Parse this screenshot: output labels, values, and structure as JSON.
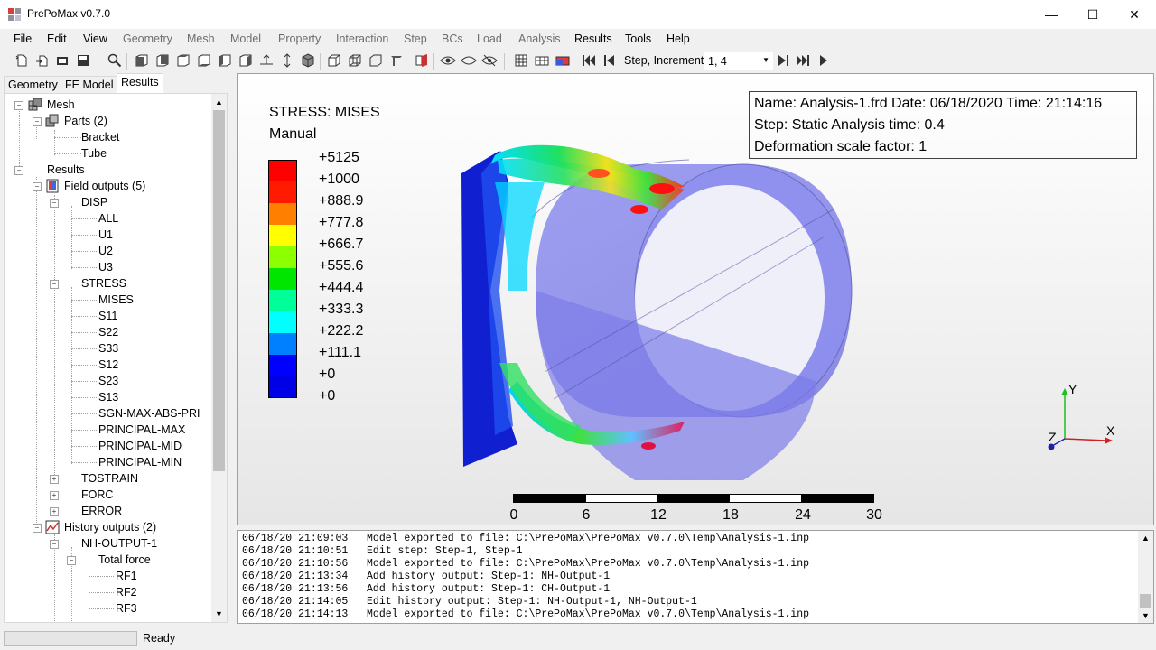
{
  "window": {
    "title": "PrePoMax v0.7.0",
    "minimize": "—",
    "maximize": "☐",
    "close": "✕"
  },
  "menu": [
    {
      "label": "File"
    },
    {
      "label": "Edit"
    },
    {
      "label": "View"
    },
    {
      "label": "Geometry"
    },
    {
      "label": "Mesh"
    },
    {
      "label": "Model"
    },
    {
      "label": "Property"
    },
    {
      "label": "Interaction"
    },
    {
      "label": "Step"
    },
    {
      "label": "BCs"
    },
    {
      "label": "Load"
    },
    {
      "label": "Analysis"
    },
    {
      "label": "Results"
    },
    {
      "label": "Tools"
    },
    {
      "label": "Help"
    }
  ],
  "toolbar": {
    "step_label": "Step, Increment",
    "step_value": "1, 4"
  },
  "left_tabs": [
    "Geometry",
    "FE Model",
    "Results"
  ],
  "tree": {
    "mesh": "Mesh",
    "parts": "Parts (2)",
    "bracket": "Bracket",
    "tube": "Tube",
    "results": "Results",
    "field_outputs": "Field outputs (5)",
    "disp": "DISP",
    "all": "ALL",
    "u1": "U1",
    "u2": "U2",
    "u3": "U3",
    "stress": "STRESS",
    "mises": "MISES",
    "s11": "S11",
    "s22": "S22",
    "s33": "S33",
    "s12": "S12",
    "s23": "S23",
    "s13": "S13",
    "sgn": "SGN-MAX-ABS-PRI",
    "pmax": "PRINCIPAL-MAX",
    "pmid": "PRINCIPAL-MID",
    "pmin": "PRINCIPAL-MIN",
    "tostrain": "TOSTRAIN",
    "forc": "FORC",
    "error": "ERROR",
    "history_outputs": "History outputs (2)",
    "nh_output": "NH-OUTPUT-1",
    "total_force": "Total force",
    "rf1": "RF1",
    "rf2": "RF2",
    "rf3": "RF3"
  },
  "legend": {
    "title": "STRESS: MISES",
    "mode": "Manual",
    "labels": [
      "+5125",
      "+1000",
      "+888.9",
      "+777.8",
      "+666.7",
      "+555.6",
      "+444.4",
      "+333.3",
      "+222.2",
      "+111.1",
      "+0",
      "+0"
    ],
    "colors": [
      "#ff0000",
      "#ff1a00",
      "#ff7f00",
      "#ffff00",
      "#8cff00",
      "#00e600",
      "#00ff99",
      "#00ffff",
      "#0080ff",
      "#0000ff",
      "#0000e6"
    ]
  },
  "info": {
    "line1": "Name: Analysis-1.frd   Date: 06/18/2020   Time: 21:14:16",
    "line2": "Step: Static    Analysis time: 0.4",
    "line3": "Deformation scale factor: 1"
  },
  "scale": {
    "labels": [
      "0",
      "6",
      "12",
      "18",
      "24",
      "30"
    ]
  },
  "axes": {
    "x": "X",
    "y": "Y",
    "z": "Z"
  },
  "log": [
    "06/18/20 21:09:03   Model exported to file: C:\\PrePoMax\\PrePoMax v0.7.0\\Temp\\Analysis-1.inp",
    "06/18/20 21:10:51   Edit step: Step-1, Step-1",
    "06/18/20 21:10:56   Model exported to file: C:\\PrePoMax\\PrePoMax v0.7.0\\Temp\\Analysis-1.inp",
    "06/18/20 21:13:34   Add history output: Step-1: NH-Output-1",
    "06/18/20 21:13:56   Add history output: Step-1: CH-Output-1",
    "06/18/20 21:14:05   Edit history output: Step-1: NH-Output-1, NH-Output-1",
    "06/18/20 21:14:13   Model exported to file: C:\\PrePoMax\\PrePoMax v0.7.0\\Temp\\Analysis-1.inp"
  ],
  "status": {
    "text": "Ready"
  }
}
